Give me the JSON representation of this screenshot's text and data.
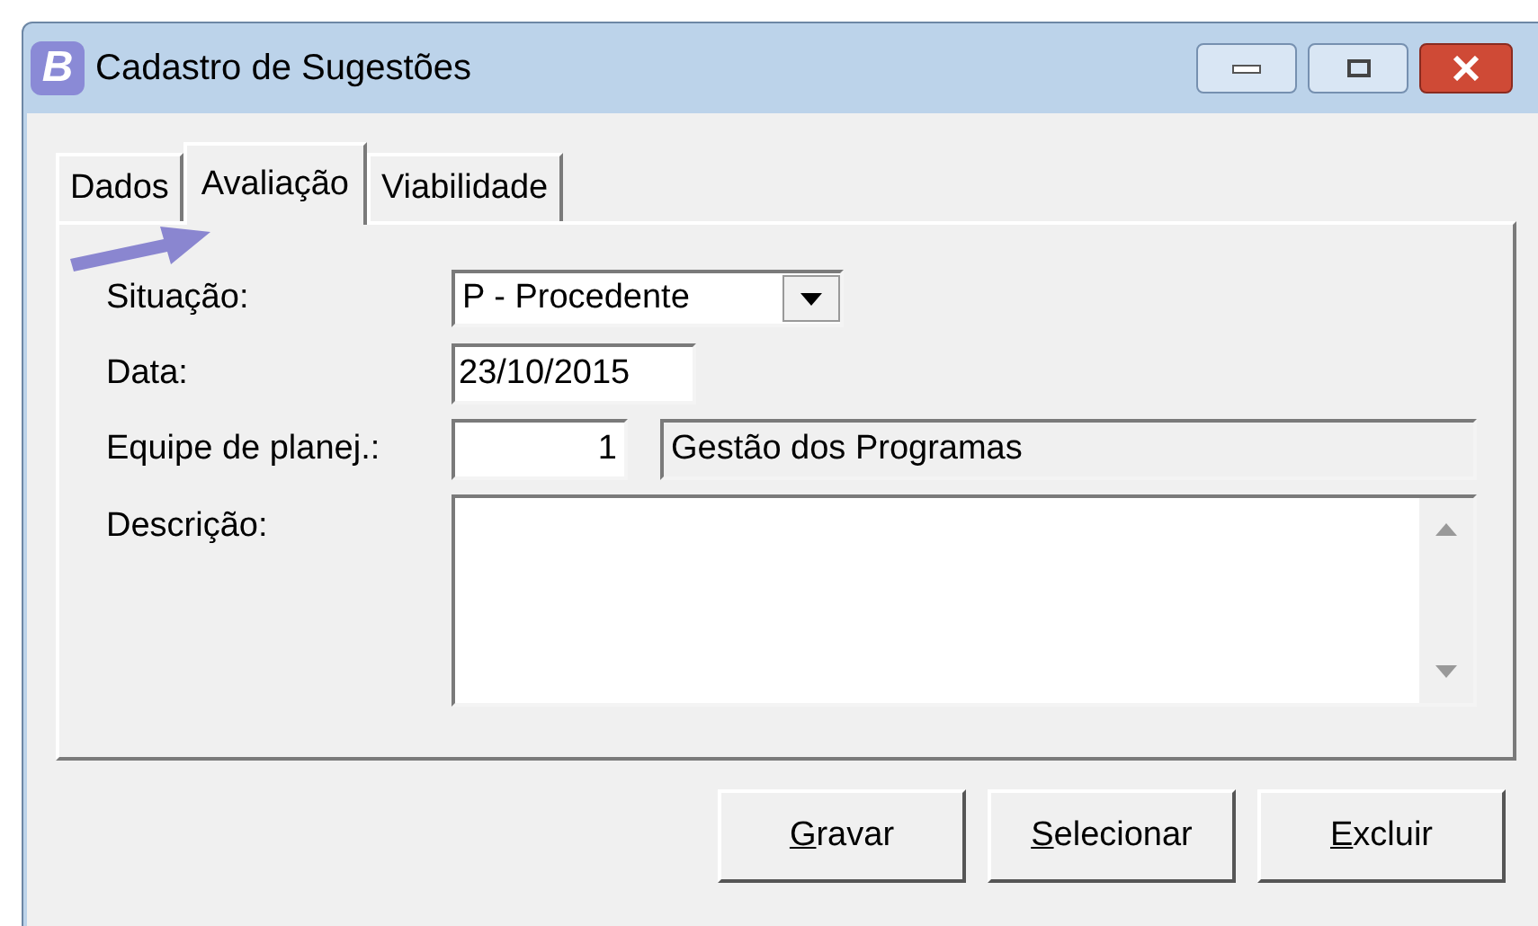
{
  "window": {
    "title": "Cadastro de Sugestões",
    "app_letter": "B"
  },
  "tabs": [
    {
      "label": "Dados",
      "selected": false
    },
    {
      "label": "Avaliação",
      "selected": true
    },
    {
      "label": "Viabilidade",
      "selected": false
    }
  ],
  "form": {
    "situacao": {
      "label": "Situação:",
      "value": "P - Procedente"
    },
    "data": {
      "label": "Data:",
      "value": "23/10/2015"
    },
    "equipe": {
      "label": "Equipe de planej.:",
      "code": "1",
      "name": "Gestão dos Programas"
    },
    "descricao": {
      "label": "Descrição:"
    }
  },
  "buttons": [
    {
      "accel": "G",
      "rest": "ravar"
    },
    {
      "accel": "S",
      "rest": "elecionar"
    },
    {
      "accel": "E",
      "rest": "xcluir"
    }
  ]
}
